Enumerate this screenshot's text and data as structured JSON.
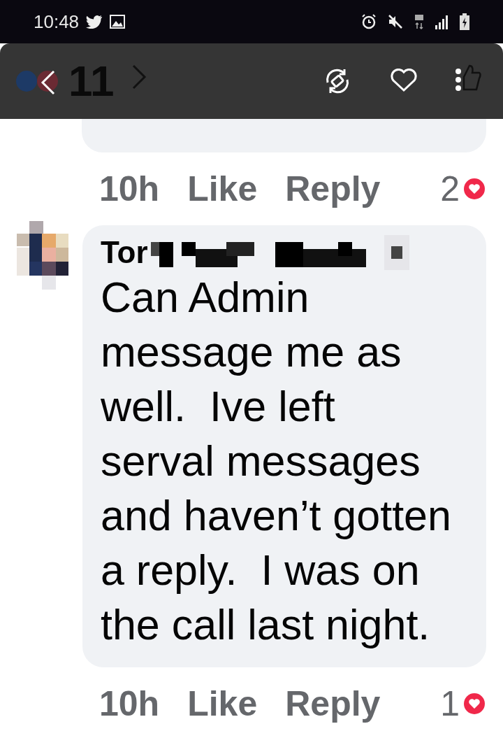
{
  "status_bar": {
    "time": "10:48"
  },
  "toolbar": {
    "reaction_count": "11"
  },
  "comments": [
    {
      "kind": "partial",
      "time": "10h",
      "like": "Like",
      "reply": "Reply",
      "reactions": "2"
    },
    {
      "kind": "full",
      "author": "Tor",
      "text_lines": [
        "Can Admin",
        "message me as",
        "well.  Ive left",
        "serval messages",
        "and haven’t gotten",
        "a reply.  I was on",
        "the call last night."
      ],
      "time": "10h",
      "like": "Like",
      "reply": "Reply",
      "reactions": "1"
    }
  ]
}
